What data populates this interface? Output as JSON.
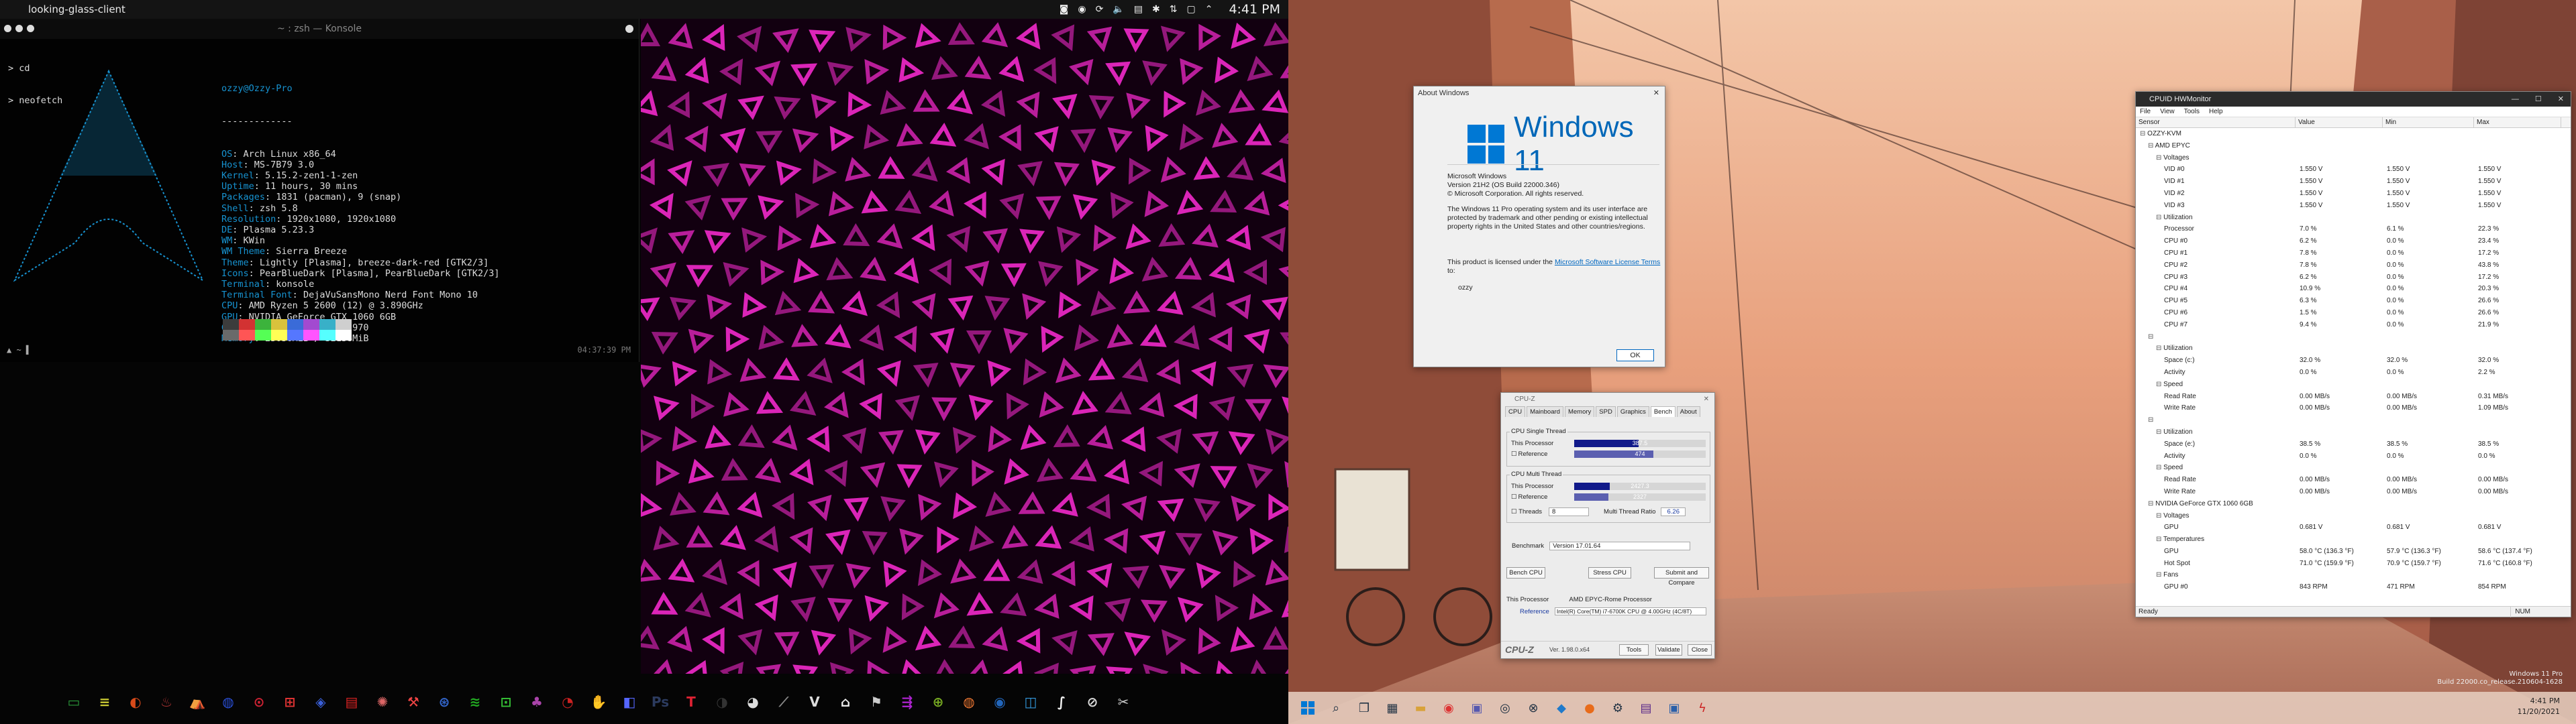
{
  "linux_panel": {
    "title": "looking-glass-client",
    "clock": "4:41 PM"
  },
  "konsole": {
    "title": "~ : zsh — Konsole",
    "line1": "> cd",
    "line2": "> neofetch",
    "user_host": "ozzy@Ozzy-Pro",
    "separator": "-------------",
    "info": [
      {
        "k": "OS",
        "v": "Arch Linux x86_64"
      },
      {
        "k": "Host",
        "v": "MS-7B79 3.0"
      },
      {
        "k": "Kernel",
        "v": "5.15.2-zen1-1-zen"
      },
      {
        "k": "Uptime",
        "v": "11 hours, 30 mins"
      },
      {
        "k": "Packages",
        "v": "1831 (pacman), 9 (snap)"
      },
      {
        "k": "Shell",
        "v": "zsh 5.8"
      },
      {
        "k": "Resolution",
        "v": "1920x1080, 1920x1080"
      },
      {
        "k": "DE",
        "v": "Plasma 5.23.3"
      },
      {
        "k": "WM",
        "v": "KWin"
      },
      {
        "k": "WM Theme",
        "v": "Sierra Breeze"
      },
      {
        "k": "Theme",
        "v": "Lightly [Plasma], breeze-dark-red [GTK2/3]"
      },
      {
        "k": "Icons",
        "v": "PearBlueDark [Plasma], PearBlueDark [GTK2/3]"
      },
      {
        "k": "Terminal",
        "v": "konsole"
      },
      {
        "k": "Terminal Font",
        "v": "DejaVuSansMono Nerd Font Mono 10"
      },
      {
        "k": "CPU",
        "v": "AMD Ryzen 5 2600 (12) @ 3.890GHz"
      },
      {
        "k": "GPU",
        "v": "NVIDIA GeForce GTX 1060 6GB"
      },
      {
        "k": "GPU",
        "v": "NVIDIA GeForce GTX 970"
      },
      {
        "k": "Memory",
        "v": "23036MiB / 32138MiB"
      }
    ],
    "prompt_time": "04:37:39 PM",
    "palette": [
      "#3c3c3c",
      "#d23232",
      "#3cb33c",
      "#d8c23c",
      "#3a6bd8",
      "#a24ad0",
      "#38b0c8",
      "#cfcfcf",
      "#6a6a6a",
      "#ff5555",
      "#55ff55",
      "#ffff55",
      "#5577ff",
      "#ff55ff",
      "#55ffff",
      "#ffffff"
    ]
  },
  "about": {
    "title": "About Windows",
    "brand": "Windows 11",
    "lines": [
      "Microsoft Windows",
      "Version 21H2 (OS Build 22000.346)",
      "© Microsoft Corporation. All rights reserved.",
      "",
      "The Windows 11 Pro operating system and its user interface are protected by trademark and other pending or existing intellectual property rights in the United States and other countries/regions."
    ],
    "license_pre": "This product is licensed under the",
    "license_link": "Microsoft Software License Terms",
    "license_post": "to:",
    "licensee": "ozzy",
    "ok": "OK"
  },
  "cpuz": {
    "title": "CPU-Z",
    "tabs": [
      "CPU",
      "Mainboard",
      "Memory",
      "SPD",
      "Graphics",
      "Bench",
      "About"
    ],
    "single_label": "CPU Single Thread",
    "multi_label": "CPU Multi Thread",
    "this_processor": "This Processor",
    "reference": "Reference",
    "single_this": "387.5",
    "single_ref": "474",
    "single_this_frac": 0.49,
    "single_ref_frac": 0.6,
    "multi_this": "2427.3",
    "multi_ref": "2327",
    "multi_this_frac": 0.27,
    "multi_ref_frac": 0.26,
    "threads_label": "Threads",
    "threads_val": "8",
    "ratio_label": "Multi Thread Ratio",
    "ratio_val": "6.26",
    "benchmark_label": "Benchmark",
    "benchmark_val": "Version 17.01.64",
    "btn_bench": "Bench CPU",
    "btn_stress": "Stress CPU",
    "btn_submit": "Submit and Compare",
    "proc_val": "AMD EPYC-Rome Processor",
    "ref_val": "Intel(R) Core(TM) i7-6700K CPU @ 4.00GHz (4C/8T)",
    "footer_brand": "CPU-Z",
    "footer_ver": "Ver. 1.98.0.x64",
    "tools": "Tools",
    "validate": "Validate",
    "close": "Close"
  },
  "hwm": {
    "title": "CPUID HWMonitor",
    "menu": [
      "File",
      "View",
      "Tools",
      "Help"
    ],
    "cols": [
      "Sensor",
      "Value",
      "Min",
      "Max"
    ],
    "rows": [
      {
        "n": "OZZY-KVM",
        "v": "",
        "mn": "",
        "mx": "",
        "l": 0
      },
      {
        "n": "AMD EPYC",
        "v": "",
        "mn": "",
        "mx": "",
        "l": 1
      },
      {
        "n": "Voltages",
        "v": "",
        "mn": "",
        "mx": "",
        "l": 2
      },
      {
        "n": "VID #0",
        "v": "1.550 V",
        "mn": "1.550 V",
        "mx": "1.550 V",
        "l": 3
      },
      {
        "n": "VID #1",
        "v": "1.550 V",
        "mn": "1.550 V",
        "mx": "1.550 V",
        "l": 3
      },
      {
        "n": "VID #2",
        "v": "1.550 V",
        "mn": "1.550 V",
        "mx": "1.550 V",
        "l": 3
      },
      {
        "n": "VID #3",
        "v": "1.550 V",
        "mn": "1.550 V",
        "mx": "1.550 V",
        "l": 3
      },
      {
        "n": "Utilization",
        "v": "",
        "mn": "",
        "mx": "",
        "l": 2
      },
      {
        "n": "Processor",
        "v": "7.0 %",
        "mn": "6.1 %",
        "mx": "22.3 %",
        "l": 3
      },
      {
        "n": "CPU #0",
        "v": "6.2 %",
        "mn": "0.0 %",
        "mx": "23.4 %",
        "l": 3
      },
      {
        "n": "CPU #1",
        "v": "7.8 %",
        "mn": "0.0 %",
        "mx": "17.2 %",
        "l": 3
      },
      {
        "n": "CPU #2",
        "v": "7.8 %",
        "mn": "0.0 %",
        "mx": "43.8 %",
        "l": 3
      },
      {
        "n": "CPU #3",
        "v": "6.2 %",
        "mn": "0.0 %",
        "mx": "17.2 %",
        "l": 3
      },
      {
        "n": "CPU #4",
        "v": "10.9 %",
        "mn": "0.0 %",
        "mx": "20.3 %",
        "l": 3
      },
      {
        "n": "CPU #5",
        "v": "6.3 %",
        "mn": "0.0 %",
        "mx": "26.6 %",
        "l": 3
      },
      {
        "n": "CPU #6",
        "v": "1.5 %",
        "mn": "0.0 %",
        "mx": "26.6 %",
        "l": 3
      },
      {
        "n": "CPU #7",
        "v": "9.4 %",
        "mn": "0.0 %",
        "mx": "21.9 %",
        "l": 3
      },
      {
        "n": "",
        "v": "",
        "mn": "",
        "mx": "",
        "l": 1
      },
      {
        "n": "Utilization",
        "v": "",
        "mn": "",
        "mx": "",
        "l": 2
      },
      {
        "n": "Space (c:)",
        "v": "32.0 %",
        "mn": "32.0 %",
        "mx": "32.0 %",
        "l": 3
      },
      {
        "n": "Activity",
        "v": "0.0 %",
        "mn": "0.0 %",
        "mx": "2.2 %",
        "l": 3
      },
      {
        "n": "Speed",
        "v": "",
        "mn": "",
        "mx": "",
        "l": 2
      },
      {
        "n": "Read Rate",
        "v": "0.00 MB/s",
        "mn": "0.00 MB/s",
        "mx": "0.31 MB/s",
        "l": 3
      },
      {
        "n": "Write Rate",
        "v": "0.00 MB/s",
        "mn": "0.00 MB/s",
        "mx": "1.09 MB/s",
        "l": 3
      },
      {
        "n": "",
        "v": "",
        "mn": "",
        "mx": "",
        "l": 1
      },
      {
        "n": "Utilization",
        "v": "",
        "mn": "",
        "mx": "",
        "l": 2
      },
      {
        "n": "Space (e:)",
        "v": "38.5 %",
        "mn": "38.5 %",
        "mx": "38.5 %",
        "l": 3
      },
      {
        "n": "Activity",
        "v": "0.0 %",
        "mn": "0.0 %",
        "mx": "0.0 %",
        "l": 3
      },
      {
        "n": "Speed",
        "v": "",
        "mn": "",
        "mx": "",
        "l": 2
      },
      {
        "n": "Read Rate",
        "v": "0.00 MB/s",
        "mn": "0.00 MB/s",
        "mx": "0.00 MB/s",
        "l": 3
      },
      {
        "n": "Write Rate",
        "v": "0.00 MB/s",
        "mn": "0.00 MB/s",
        "mx": "0.00 MB/s",
        "l": 3
      },
      {
        "n": "NVIDIA GeForce GTX 1060 6GB",
        "v": "",
        "mn": "",
        "mx": "",
        "l": 1
      },
      {
        "n": "Voltages",
        "v": "",
        "mn": "",
        "mx": "",
        "l": 2
      },
      {
        "n": "GPU",
        "v": "0.681 V",
        "mn": "0.681 V",
        "mx": "0.681 V",
        "l": 3
      },
      {
        "n": "Temperatures",
        "v": "",
        "mn": "",
        "mx": "",
        "l": 2
      },
      {
        "n": "GPU",
        "v": "58.0 °C (136.3 °F)",
        "mn": "57.9 °C (136.3 °F)",
        "mx": "58.6 °C (137.4 °F)",
        "l": 3
      },
      {
        "n": "Hot Spot",
        "v": "71.0 °C (159.9 °F)",
        "mn": "70.9 °C (159.7 °F)",
        "mx": "71.6 °C (160.8 °F)",
        "l": 3
      },
      {
        "n": "Fans",
        "v": "",
        "mn": "",
        "mx": "",
        "l": 2
      },
      {
        "n": "GPU #0",
        "v": "843 RPM",
        "mn": "471 RPM",
        "mx": "854 RPM",
        "l": 3
      }
    ],
    "status": "Ready",
    "num": "NUM"
  },
  "win_clock": {
    "time": "4:41 PM",
    "date": "11/20/2021"
  },
  "watermark": {
    "l1": "Windows 11 Pro",
    "l2": "Build 22000.co_release.210604-1628"
  }
}
